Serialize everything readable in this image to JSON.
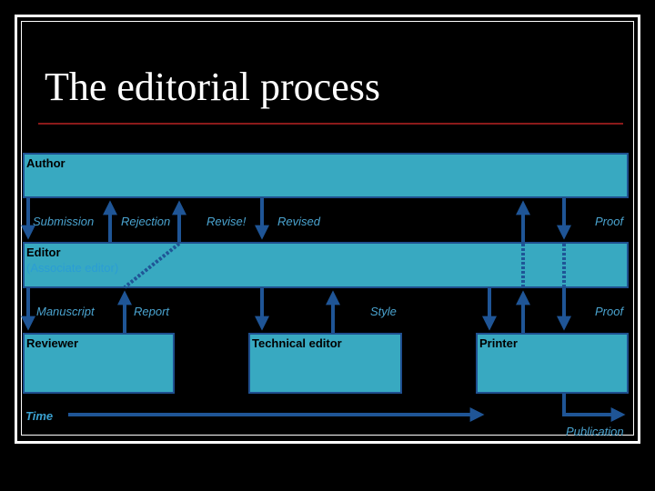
{
  "slide": {
    "title": "The editorial process",
    "colors": {
      "box_fill": "#38a9c1",
      "box_border": "#1f4f8f",
      "arrow": "#1f5596",
      "rule": "#8b1a1a",
      "label": "#4aa3cf"
    }
  },
  "actors": {
    "author": {
      "label": "Author"
    },
    "editor": {
      "label": "Editor",
      "sublabel": "(Associate editor)"
    },
    "reviewer": {
      "label": "Reviewer"
    },
    "technical_editor": {
      "label": "Technical editor"
    },
    "printer": {
      "label": "Printer"
    }
  },
  "flows": {
    "submission": "Submission",
    "rejection": "Rejection",
    "revise": "Revise!",
    "revised": "Revised",
    "proof_author": "Proof",
    "manuscript": "Manuscript",
    "report": "Report",
    "style": "Style",
    "proof_printer": "Proof",
    "publication": "Publication"
  },
  "timeline": {
    "label": "Time"
  }
}
